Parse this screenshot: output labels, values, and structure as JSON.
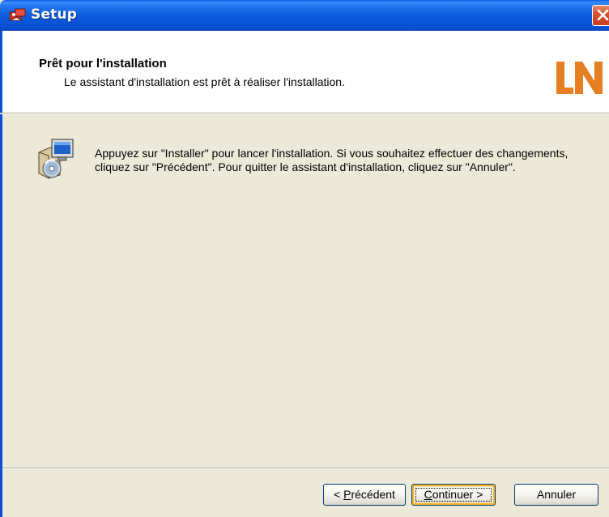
{
  "window": {
    "title": "Setup",
    "close_icon": "close-icon"
  },
  "header": {
    "title": "Prêt pour l'installation",
    "subtitle": "Le assistant d'installation est prêt à réaliser l'installation.",
    "logo_text": "LN",
    "logo_color": "#e67e22"
  },
  "main": {
    "icon": "setup-package-icon",
    "message": "Appuyez sur \"Installer\" pour lancer l'installation. Si vous souhaitez effectuer des changements, cliquez sur \"Précédent\". Pour quitter le assistant d'installation, cliquez sur \"Annuler\"."
  },
  "buttons": {
    "back": {
      "prefix": "< ",
      "mnemonic": "P",
      "rest": "récédent"
    },
    "next": {
      "mnemonic": "C",
      "rest": "ontinuer",
      "suffix": " >"
    },
    "cancel": {
      "label": "Annuler"
    }
  },
  "colors": {
    "titlebar": "#0a50d2",
    "dialog_bg": "#ece9d8",
    "header_bg": "#ffffff",
    "close_button": "#d9542f"
  }
}
